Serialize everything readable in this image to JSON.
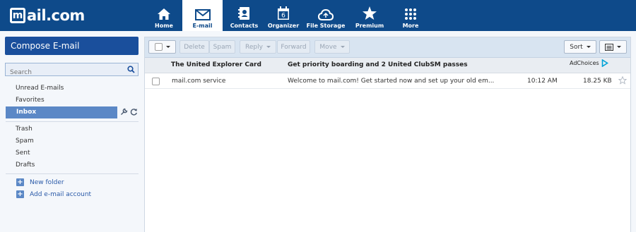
{
  "brand": {
    "logo_mark": "m",
    "logo_text": "ail.com"
  },
  "nav": [
    {
      "label": "Home",
      "icon": "home-icon"
    },
    {
      "label": "E-mail",
      "icon": "envelope-icon",
      "active": true
    },
    {
      "label": "Contacts",
      "icon": "address-book-icon"
    },
    {
      "label": "Organizer",
      "icon": "calendar-icon",
      "calendar_day": "6"
    },
    {
      "label": "File Storage",
      "icon": "cloud-icon"
    },
    {
      "label": "Premium",
      "icon": "star-icon"
    },
    {
      "label": "More",
      "icon": "grid-icon"
    }
  ],
  "sidebar": {
    "compose_label": "Compose E-mail",
    "search_placeholder": "Search",
    "folders_top": [
      "Unread E-mails",
      "Favorites"
    ],
    "inbox_label": "Inbox",
    "folders_bottom": [
      "Trash",
      "Spam",
      "Sent",
      "Drafts"
    ],
    "actions": [
      "New folder",
      "Add e-mail account"
    ]
  },
  "toolbar": {
    "delete": "Delete",
    "spam": "Spam",
    "reply": "Reply",
    "forward": "Forward",
    "move": "Move",
    "sort": "Sort"
  },
  "ad": {
    "title": "The United Explorer Card",
    "text": "Get priority boarding and 2 United ClubSM passes",
    "adchoices": "AdChoices"
  },
  "messages": [
    {
      "from": "mail.com service",
      "subject": "Welcome to mail.com! Get started now and set up your old em...",
      "time": "10:12 AM",
      "size": "18.25 KB"
    }
  ],
  "colors": {
    "topbar": "#0e4a8a",
    "compose": "#1a4f9c",
    "inbox_selected": "#5b88c6",
    "toolbar": "#d8e4f1"
  }
}
